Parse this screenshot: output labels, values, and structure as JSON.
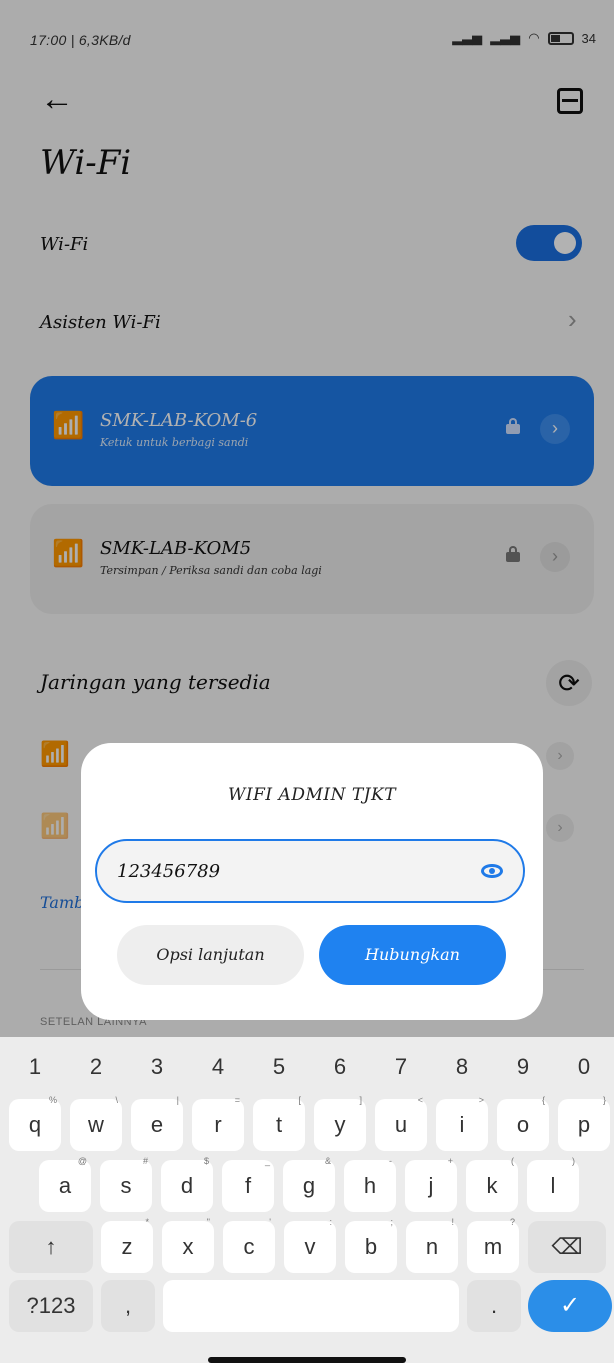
{
  "status": {
    "time_speed": "17:00 | 6,3KB/d",
    "icons": [
      "hotspot-icon",
      "alarm-icon",
      "screenshot-icon"
    ],
    "battery": "34"
  },
  "header": {
    "title": "Wi-Fi"
  },
  "settings": {
    "wifi_label": "Wi-Fi",
    "wifi_enabled": true,
    "assistant_label": "Asisten Wi-Fi"
  },
  "networks_saved": [
    {
      "name": "SMK-LAB-KOM-6",
      "status": "Ketuk untuk berbagi sandi",
      "connected": true
    },
    {
      "name": "SMK-LAB-KOM5",
      "status": "Tersimpan / Periksa sandi dan coba lagi",
      "connected": false
    }
  ],
  "available": {
    "section_title": "Jaringan yang tersedia",
    "add_label": "Tamb",
    "bottom_section": "SETELAN LAINNYA"
  },
  "dialog": {
    "title": "WIFI ADMIN TJKT",
    "password_value": "123456789",
    "options_label": "Opsi lanjutan",
    "connect_label": "Hubungkan"
  },
  "keyboard": {
    "numbers": [
      "1",
      "2",
      "3",
      "4",
      "5",
      "6",
      "7",
      "8",
      "9",
      "0"
    ],
    "row1": [
      {
        "k": "q",
        "h": "%"
      },
      {
        "k": "w",
        "h": "\\"
      },
      {
        "k": "e",
        "h": "|"
      },
      {
        "k": "r",
        "h": "="
      },
      {
        "k": "t",
        "h": "["
      },
      {
        "k": "y",
        "h": "]"
      },
      {
        "k": "u",
        "h": "<"
      },
      {
        "k": "i",
        "h": ">"
      },
      {
        "k": "o",
        "h": "{"
      },
      {
        "k": "p",
        "h": "}"
      }
    ],
    "row2": [
      {
        "k": "a",
        "h": "@"
      },
      {
        "k": "s",
        "h": "#"
      },
      {
        "k": "d",
        "h": "$"
      },
      {
        "k": "f",
        "h": "_"
      },
      {
        "k": "g",
        "h": "&"
      },
      {
        "k": "h",
        "h": "-"
      },
      {
        "k": "j",
        "h": "+"
      },
      {
        "k": "k",
        "h": "("
      },
      {
        "k": "l",
        "h": ")"
      }
    ],
    "row3": [
      {
        "k": "z",
        "h": "*"
      },
      {
        "k": "x",
        "h": "\""
      },
      {
        "k": "c",
        "h": "'"
      },
      {
        "k": "v",
        "h": ":"
      },
      {
        "k": "b",
        "h": ";"
      },
      {
        "k": "n",
        "h": "!"
      },
      {
        "k": "m",
        "h": "?"
      }
    ],
    "shift": "↑",
    "backspace": "⌫",
    "sym": "?123",
    "comma": ",",
    "period": ".",
    "enter": "✓"
  },
  "colors": {
    "accent": "#1f7ae8",
    "toggle": "#1b6fe0",
    "connect": "#1f82f0"
  }
}
